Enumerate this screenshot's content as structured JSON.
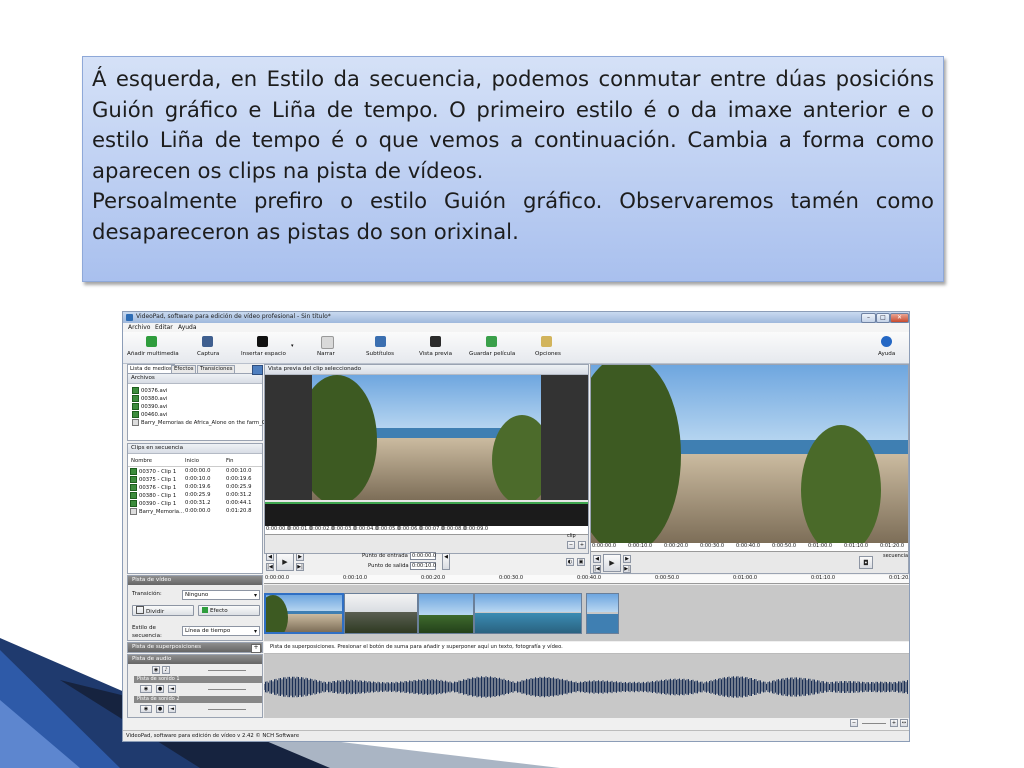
{
  "caption": {
    "paragraph1": "Á esquerda, en Estilo da secuencia, podemos conmutar entre dúas posicións Guión gráfico e Liña de tempo. O primeiro estilo é o da imaxe anterior e o estilo Liña de tempo é o que vemos a continuación. Cambia a forma como aparecen os clips na pista de vídeos.",
    "paragraph2": "Persoalmente prefiro o estilo Guión gráfico. Observaremos tamén como desapareceron as pistas do son orixinal."
  },
  "window": {
    "title": "VideoPad, software para edición de vídeo profesional - Sin título*",
    "menu": [
      "Archivo",
      "Editar",
      "Ayuda"
    ],
    "status": "VideoPad, software para edición de vídeo v 2.42 © NCH Software"
  },
  "toolbar": {
    "buttons": [
      {
        "label": "Añadir multimedia",
        "icon": "add-media-icon"
      },
      {
        "label": "Captura",
        "icon": "capture-icon"
      },
      {
        "label": "Insertar espacio",
        "icon": "insert-space-icon"
      },
      {
        "label": "Narrar",
        "icon": "narrate-icon"
      },
      {
        "label": "Subtítulos",
        "icon": "subtitles-icon"
      },
      {
        "label": "Vista previa",
        "icon": "preview-icon"
      },
      {
        "label": "Guardar película",
        "icon": "save-movie-icon"
      },
      {
        "label": "Opciones",
        "icon": "options-icon"
      },
      {
        "label": "Ayuda",
        "icon": "help-icon"
      }
    ]
  },
  "media": {
    "tabs": [
      "Lista de medios",
      "Efectos",
      "Transiciones"
    ],
    "files_header": "Archivos",
    "files": [
      "00376.avi",
      "00380.avi",
      "00390.avi",
      "00460.avi",
      "Barry_Memorias de Africa_Alone on the farm_CU"
    ]
  },
  "sequence": {
    "header": "Clips en secuencia",
    "columns": [
      "Nombre",
      "Inicio",
      "Fin"
    ],
    "rows": [
      {
        "name": "00370 - Clip 1",
        "start": "0:00:00.0",
        "end": "0:00:10.0"
      },
      {
        "name": "00375 - Clip 1",
        "start": "0:00:10.0",
        "end": "0:00:19.6"
      },
      {
        "name": "00376 - Clip 1",
        "start": "0:00:19.6",
        "end": "0:00:25.9"
      },
      {
        "name": "00380 - Clip 1",
        "start": "0:00:25.9",
        "end": "0:00:31.2"
      },
      {
        "name": "00390 - Clip 1",
        "start": "0:00:31.2",
        "end": "0:00:44.1"
      },
      {
        "name": "Barry_Memoria...",
        "start": "0:00:00.0",
        "end": "0:01:20.8"
      }
    ]
  },
  "preview": {
    "header": "Vista previa del clip seleccionado",
    "in_label": "Punto de entrada",
    "in_value": "0:00:00.0",
    "out_label": "Punto de salida",
    "out_value": "0:00:10.0",
    "clip_label": "clip",
    "secuencia_label": "secuencia"
  },
  "clip_ruler": [
    "0:00:00.0",
    "0:00:01.0",
    "0:00:02.0",
    "0:00:03.0",
    "0:00:04.0",
    "0:00:05.0",
    "0:00:06.0",
    "0:00:07.0",
    "0:00:08.0",
    "0:00:09.0"
  ],
  "seq_ruler": [
    "0:00:00.0",
    "0:00:10.0",
    "0:00:20.0",
    "0:00:30.0",
    "0:00:40.0",
    "0:00:50.0",
    "0:01:00.0",
    "0:01:10.0",
    "0:01:20.0"
  ],
  "timeline_ruler": [
    "0:00:00.0",
    "0:00:10.0",
    "0:00:20.0",
    "0:00:30.0",
    "0:00:40.0",
    "0:00:50.0",
    "0:01:00.0",
    "0:01:10.0",
    "0:01:20.0"
  ],
  "video_track": {
    "header": "Pista de vídeo",
    "transition_label": "Transición:",
    "transition_value": "Ninguno",
    "split_label": "Dividir",
    "effect_label": "Efecto",
    "style_label_1": "Estilo de",
    "style_label_2": "secuencia:",
    "style_value": "Línea de tiempo"
  },
  "overlay": {
    "header": "Pista de superposiciones",
    "hint": "Pista de superposiciones. Presionar el botón de suma para añadir y superponer aquí un texto, fotografía y vídeo."
  },
  "audio": {
    "header": "Pista de audio",
    "track1": "Pista de sonido 1",
    "track2": "Pista de sonido 2"
  },
  "colors": {
    "caption_bg": "#b7caf2",
    "accent_dark": "#1f3864",
    "titlebar": "#b4c9e8",
    "wave": "#1b2f55"
  }
}
